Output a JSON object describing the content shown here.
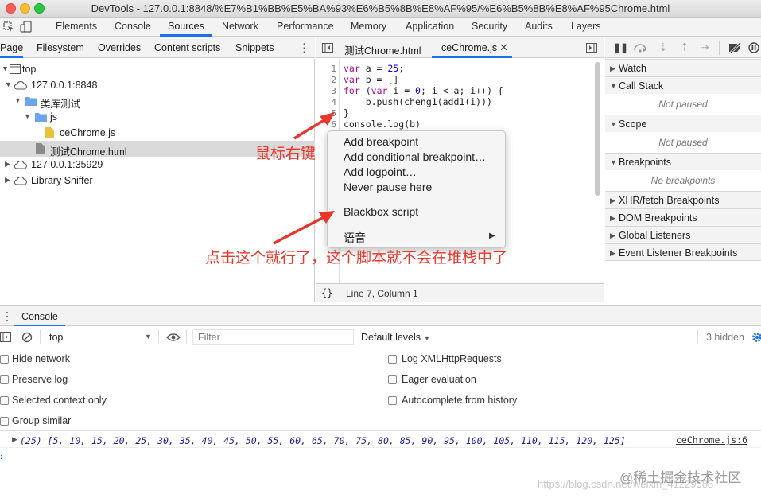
{
  "window": {
    "title": "DevTools - 127.0.0.1:8848/%E7%B1%BB%E5%BA%93%E6%B5%8B%E8%AF%95/%E6%B5%8B%E8%AF%95Chrome.html"
  },
  "main_tabs": [
    "Elements",
    "Console",
    "Sources",
    "Network",
    "Performance",
    "Memory",
    "Application",
    "Security",
    "Audits",
    "Layers"
  ],
  "nav_tabs": [
    "Page",
    "Filesystem",
    "Overrides",
    "Content scripts",
    "Snippets"
  ],
  "tree": {
    "top": "top",
    "host1": "127.0.0.1:8848",
    "folder": "类库测试",
    "subfolder": "js",
    "file_js": "ceChrome.js",
    "file_html": "测试Chrome.html",
    "host2": "127.0.0.1:35929",
    "sniffer": "Library Sniffer"
  },
  "editor": {
    "tab1": "测试Chrome.html",
    "tab2": "ceChrome.js",
    "line_numbers": [
      "1",
      "2",
      "3",
      "4",
      "5",
      "6"
    ],
    "status": "Line 7, Column 1"
  },
  "debugger": {
    "watch": "Watch",
    "call_stack": "Call Stack",
    "not_paused_1": "Not paused",
    "scope": "Scope",
    "not_paused_2": "Not paused",
    "breakpoints": "Breakpoints",
    "no_breakpoints": "No breakpoints",
    "xhr": "XHR/fetch Breakpoints",
    "dom": "DOM Breakpoints",
    "global": "Global Listeners",
    "event": "Event Listener Breakpoints"
  },
  "context_menu": {
    "items": [
      "Add breakpoint",
      "Add conditional breakpoint…",
      "Add logpoint…",
      "Never pause here"
    ],
    "blackbox": "Blackbox script",
    "language": "语音"
  },
  "annotations": {
    "right_click": "鼠标右键",
    "click_hint": "点击这个就行了，这个脚本就不会在堆栈中了"
  },
  "drawer": {
    "tab": "Console",
    "context": "top",
    "filter_placeholder": "Filter",
    "levels": "Default levels",
    "hidden": "3 hidden"
  },
  "settings": {
    "left": [
      "Hide network",
      "Preserve log",
      "Selected context only",
      "Group similar"
    ],
    "right": [
      "Log XMLHttpRequests",
      "Eager evaluation",
      "Autocomplete from history"
    ]
  },
  "log": {
    "output": "(25) [5, 10, 15, 20, 25, 30, 35, 40, 45, 50, 55, 60, 65, 70, 75, 80, 85, 90, 95, 100, 105, 110, 115, 120, 125]",
    "source": "ceChrome.js:6"
  },
  "watermark": {
    "url": "https://blog.csdn.net/weixin_41229588",
    "brand": "@稀土掘金技术社区"
  },
  "colors": {
    "accent": "#1a73e8",
    "annotation": "#e8362a",
    "folder": "#6aa6e8",
    "js_file": "#e9c13c"
  }
}
